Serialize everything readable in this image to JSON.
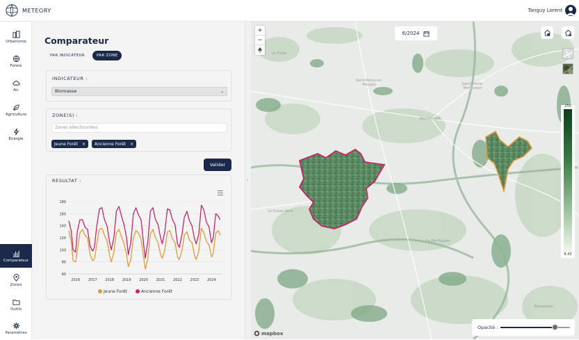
{
  "app": {
    "name": "METEORY"
  },
  "user": {
    "name": "Tanguy Lorent"
  },
  "sidebar": {
    "items": [
      {
        "label": "Urbanisme",
        "icon": "building-icon"
      },
      {
        "label": "Forets",
        "icon": "globe-icon"
      },
      {
        "label": "Air",
        "icon": "cloud-icon"
      },
      {
        "label": "Agriculture",
        "icon": "leaf-icon"
      },
      {
        "label": "Energie",
        "icon": "bolt-icon"
      },
      {
        "label": "Comparateur",
        "icon": "chart-bars-icon",
        "active": true
      },
      {
        "label": "Zones",
        "icon": "map-pin-icon"
      },
      {
        "label": "Outils",
        "icon": "folder-icon"
      },
      {
        "label": "Paramètres",
        "icon": "gear-icon"
      }
    ]
  },
  "panel": {
    "title": "Comparateur",
    "toggle_indicator": "PAR INDICATEUR",
    "toggle_zone": "PAR ZONE",
    "indicator_label": "INDICATEUR :",
    "indicator_value": "Biomasse",
    "zones_label": "ZONE(S) :",
    "zones_placeholder": "Zones sélectionnées",
    "chips": [
      "Jeune Forêt",
      "Ancienne Forêt"
    ],
    "validate": "Valider",
    "result_label": "RESULTAT :"
  },
  "chart_data": {
    "type": "line",
    "title": "",
    "xlabel": "",
    "ylabel": "",
    "xlim": [
      2015.6,
      2024.6
    ],
    "ylim": [
      60,
      180
    ],
    "x_ticks": [
      "2016",
      "2017",
      "2018",
      "2019",
      "2020",
      "2021",
      "2022",
      "2023",
      "2024"
    ],
    "y_ticks": [
      "60",
      "80",
      "100",
      "120",
      "140",
      "160",
      "180"
    ],
    "legend_position": "bottom",
    "series": [
      {
        "name": "Jeune Forêt",
        "color": "#e39a3b",
        "x": [
          2015.6,
          2015.75,
          2015.85,
          2016.0,
          2016.1,
          2016.25,
          2016.4,
          2016.55,
          2016.7,
          2016.85,
          2017.0,
          2017.1,
          2017.25,
          2017.4,
          2017.55,
          2017.7,
          2017.85,
          2018.0,
          2018.1,
          2018.25,
          2018.4,
          2018.55,
          2018.7,
          2018.85,
          2019.0,
          2019.1,
          2019.25,
          2019.4,
          2019.55,
          2019.7,
          2019.85,
          2020.0,
          2020.1,
          2020.25,
          2020.4,
          2020.55,
          2020.7,
          2020.85,
          2021.0,
          2021.1,
          2021.25,
          2021.4,
          2021.55,
          2021.7,
          2021.85,
          2022.0,
          2022.1,
          2022.25,
          2022.4,
          2022.55,
          2022.7,
          2022.85,
          2023.0,
          2023.1,
          2023.25,
          2023.4,
          2023.55,
          2023.7,
          2023.85,
          2024.0,
          2024.1,
          2024.25,
          2024.4,
          2024.5
        ],
        "y": [
          132,
          112,
          82,
          80,
          98,
          128,
          134,
          124,
          120,
          92,
          82,
          84,
          110,
          134,
          136,
          124,
          115,
          90,
          80,
          96,
          128,
          134,
          122,
          110,
          92,
          72,
          84,
          120,
          132,
          128,
          118,
          88,
          68,
          86,
          126,
          134,
          120,
          112,
          92,
          86,
          100,
          130,
          132,
          118,
          112,
          88,
          84,
          98,
          124,
          130,
          116,
          112,
          90,
          84,
          98,
          136,
          128,
          114,
          108,
          88,
          94,
          128,
          132,
          124
        ]
      },
      {
        "name": "Ancienne Forêt",
        "color": "#c2256a",
        "x": [
          2015.6,
          2015.75,
          2015.85,
          2016.0,
          2016.1,
          2016.25,
          2016.4,
          2016.55,
          2016.7,
          2016.85,
          2017.0,
          2017.1,
          2017.25,
          2017.4,
          2017.55,
          2017.7,
          2017.85,
          2018.0,
          2018.1,
          2018.25,
          2018.4,
          2018.55,
          2018.7,
          2018.85,
          2019.0,
          2019.1,
          2019.25,
          2019.4,
          2019.55,
          2019.7,
          2019.85,
          2020.0,
          2020.1,
          2020.25,
          2020.4,
          2020.55,
          2020.7,
          2020.85,
          2021.0,
          2021.1,
          2021.25,
          2021.4,
          2021.55,
          2021.7,
          2021.85,
          2022.0,
          2022.1,
          2022.25,
          2022.4,
          2022.55,
          2022.7,
          2022.85,
          2023.0,
          2023.1,
          2023.25,
          2023.4,
          2023.55,
          2023.7,
          2023.85,
          2024.0,
          2024.1,
          2024.25,
          2024.4,
          2024.5
        ],
        "y": [
          148,
          130,
          100,
          96,
          130,
          150,
          150,
          138,
          134,
          106,
          98,
          104,
          140,
          168,
          170,
          150,
          140,
          112,
          100,
          120,
          164,
          172,
          156,
          142,
          120,
          92,
          112,
          160,
          170,
          158,
          150,
          110,
          86,
          114,
          164,
          170,
          150,
          142,
          120,
          110,
          130,
          168,
          166,
          150,
          142,
          110,
          104,
          124,
          154,
          164,
          148,
          140,
          118,
          110,
          126,
          174,
          166,
          146,
          138,
          112,
          120,
          160,
          156,
          150
        ]
      }
    ]
  },
  "map": {
    "date": "6/2024",
    "legend_max": "250",
    "legend_min": "8.43",
    "opacity_label": "Opacité :",
    "opacity_value": 0.78,
    "attribution": "mapbox",
    "places": [
      "Le Fuilet",
      "Saint-Rémy-en-Mauges",
      "Saint-Pierre-Montlimart",
      "Montrevault",
      "Le Puiset-Doré",
      "Le Fief-Sauvin",
      "Beaupréau"
    ],
    "zone_colors": {
      "ancienne": "#c2256a",
      "jeune": "#e39a3b"
    }
  }
}
